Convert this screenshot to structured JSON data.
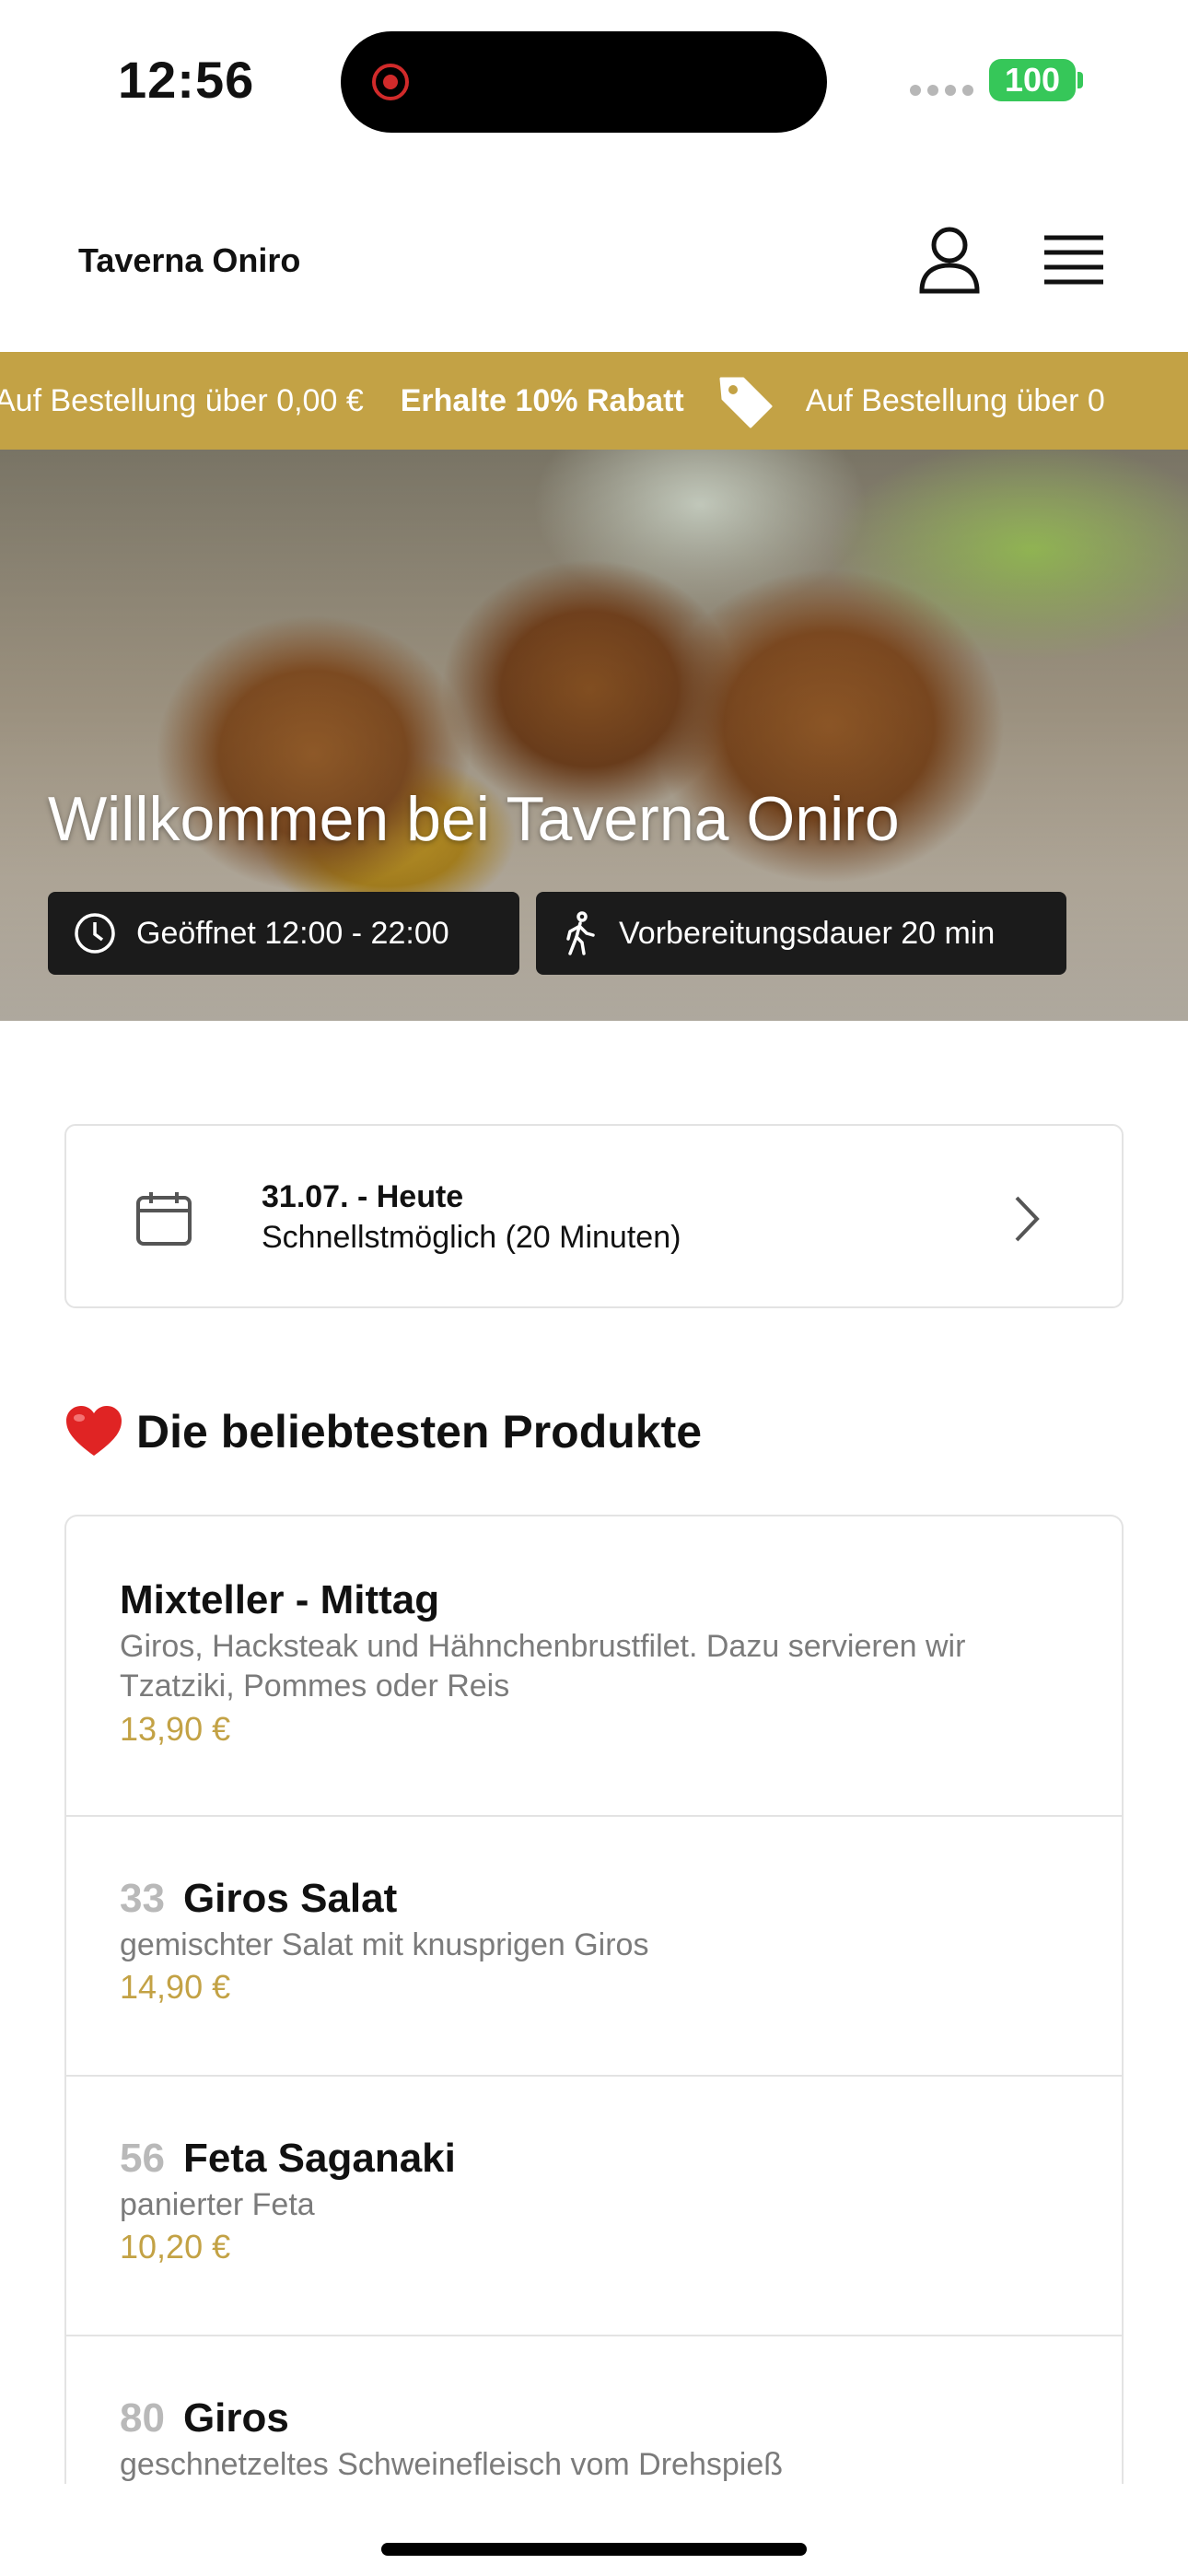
{
  "status_bar": {
    "time": "12:56",
    "battery": "100"
  },
  "header": {
    "brand": "Taverna Oniro",
    "user_icon": "user-icon",
    "menu_icon": "hamburger-menu-icon"
  },
  "promo": {
    "text_prefix": "Auf Bestellung über 0,00 €",
    "bold": "Erhalte 10% Rabatt",
    "text_suffix": "Auf Bestellung über 0",
    "background": "#c3a245",
    "icon": "tag-icon"
  },
  "hero": {
    "title": "Willkommen bei Taverna Oniro",
    "opening_hours": "Geöffnet 12:00 - 22:00",
    "prep_time": "Vorbereitungsdauer 20 min"
  },
  "date_picker": {
    "date": "31.07. - Heute",
    "slot": "Schnellstmöglich (20 Minuten)"
  },
  "popular": {
    "title": "Die beliebtesten Produkte",
    "items": [
      {
        "number": "",
        "name": "Mixteller - Mittag",
        "description": "Giros, Hacksteak und Hähnchenbrustfilet. Dazu servieren wir Tzatziki, Pommes oder Reis",
        "price": "13,90 €"
      },
      {
        "number": "33",
        "name": "Giros Salat",
        "description": "gemischter Salat mit knusprigen Giros",
        "price": "14,90 €"
      },
      {
        "number": "56",
        "name": "Feta Saganaki",
        "description": "panierter Feta",
        "price": "10,20 €"
      },
      {
        "number": "80",
        "name": "Giros",
        "description": "geschnetzeltes Schweinefleisch vom Drehspieß",
        "price": ""
      }
    ]
  },
  "colors": {
    "accent": "#c3a245",
    "chip_bg": "#1b1b1b",
    "battery": "#36c759"
  }
}
